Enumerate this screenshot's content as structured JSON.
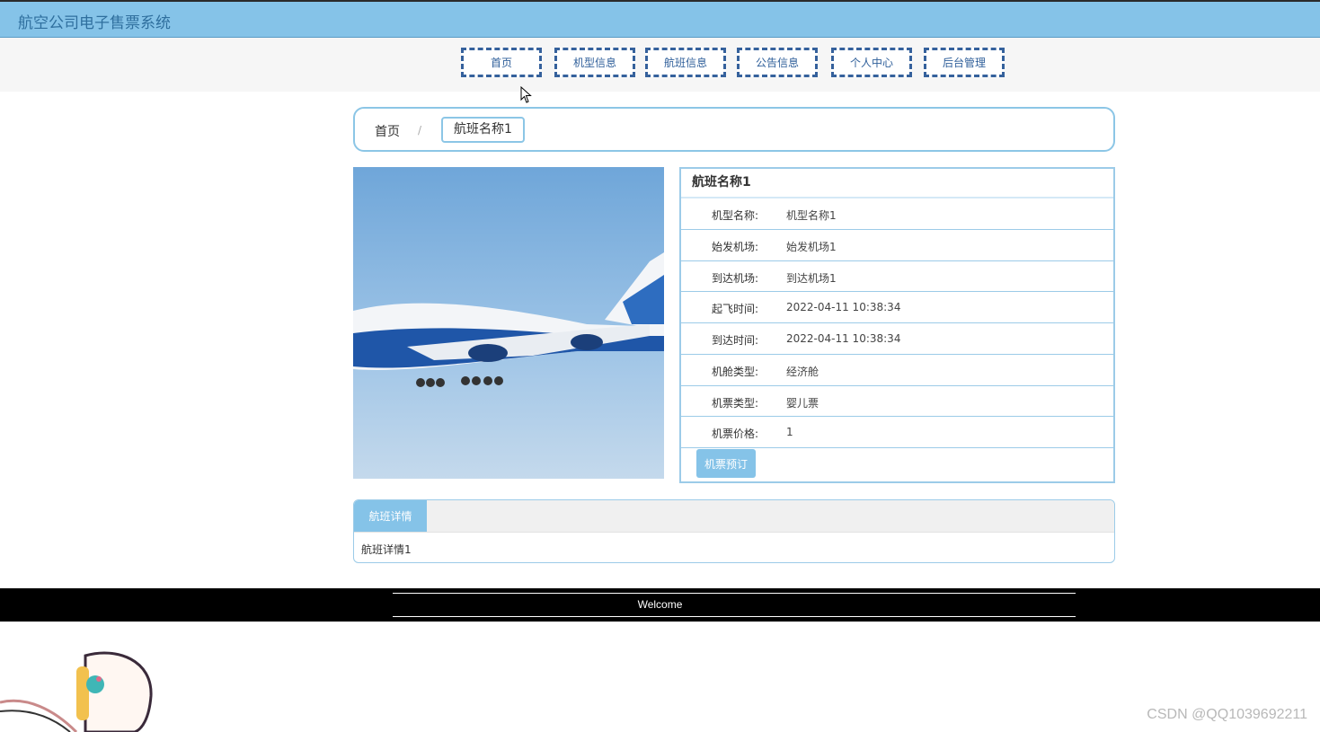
{
  "header": {
    "site_title": "航空公司电子售票系统"
  },
  "nav": [
    {
      "label": "首页"
    },
    {
      "label": "机型信息"
    },
    {
      "label": "航班信息"
    },
    {
      "label": "公告信息"
    },
    {
      "label": "个人中心"
    },
    {
      "label": "后台管理"
    }
  ],
  "breadcrumb": {
    "home": "首页",
    "separator": "/",
    "current": "航班名称1"
  },
  "flight": {
    "title": "航班名称1",
    "fields": [
      {
        "label": "机型名称:",
        "value": "机型名称1"
      },
      {
        "label": "始发机场:",
        "value": "始发机场1"
      },
      {
        "label": "到达机场:",
        "value": "到达机场1"
      },
      {
        "label": "起飞时间:",
        "value": "2022-04-11 10:38:34"
      },
      {
        "label": "到达时间:",
        "value": "2022-04-11 10:38:34"
      },
      {
        "label": "机舱类型:",
        "value": "经济舱"
      },
      {
        "label": "机票类型:",
        "value": "婴儿票"
      },
      {
        "label": "机票价格:",
        "value": "1"
      }
    ],
    "book_label": "机票预订"
  },
  "detail": {
    "tab_label": "航班详情",
    "content": "航班详情1"
  },
  "footer": {
    "text": "Welcome"
  },
  "watermark": "CSDN @QQ1039692211",
  "colors": {
    "accent": "#85c3e8",
    "nav_border": "#35619c",
    "footer_bg": "#000000"
  },
  "icons": {
    "cursor": "arrow-cursor-icon",
    "mascot": "mascot-illustration"
  }
}
